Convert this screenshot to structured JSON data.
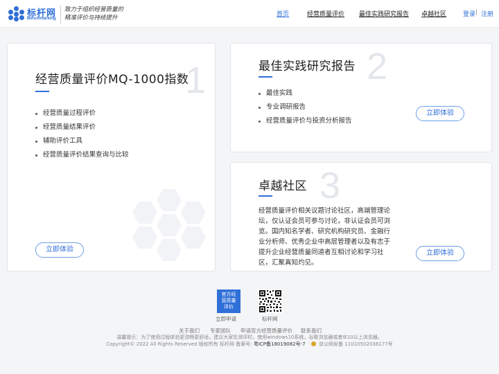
{
  "header": {
    "logo_cn": "标杆网",
    "logo_en": "Benchmarking",
    "slogan_line1": "致力于组织经营质量的",
    "slogan_line2": "精准评价与持续提升",
    "nav": [
      "首页",
      "经营质量评价",
      "最佳实践研究报告",
      "卓越社区"
    ],
    "login": "登录",
    "separator": "|",
    "register": "注册"
  },
  "card1": {
    "number": "1",
    "title": "经营质量评价MQ-1000指数",
    "items": [
      "经营质量过程评价",
      "经营质量结果评价",
      "辅助评价工具",
      "经营质量评价结果查询与比较"
    ],
    "button": "立即体验"
  },
  "card2": {
    "number": "2",
    "title": "最佳实践研究报告",
    "items": [
      "最佳实践",
      "专业调研报告",
      "经营质量评价与投资分析报告"
    ],
    "button": "立即体验"
  },
  "card3": {
    "number": "3",
    "title": "卓越社区",
    "description": "经营质量评价相关议题讨论社区，高端管理论坛，仅认证会员可参与讨论，非认证会员可浏览。国内知名学者、研究机构研究员、金融行业分析师、优秀企业中高层管理者以及有志于提升企业经营质量同道者互相讨论和学习社区，汇聚真知灼见。",
    "button": "立即体验"
  },
  "footer": {
    "apply_badge_line1": "官方经",
    "apply_badge_line2": "营质量",
    "apply_badge_line3": "评价",
    "apply_label": "立即申请",
    "qr_label": "标杆网",
    "links": [
      "关于我们",
      "专家团队",
      "申请官方经营质量评价",
      "联系我们"
    ],
    "tip": "温馨提示：为了使用过程体验更流畅更舒适，建议大家在测评时，使用windows10系统，谷歌浏览器或者IE10以上浏览器。",
    "copyright": "Copyright© 2022 All Rights Reserved 版权所有 标杆网 备案号:",
    "icp": "粤ICP备18019082号-7",
    "police": "京公网安备 11010502036177号"
  },
  "colors": {
    "accent": "#2f6fd8",
    "background": "#f4f5f7"
  }
}
